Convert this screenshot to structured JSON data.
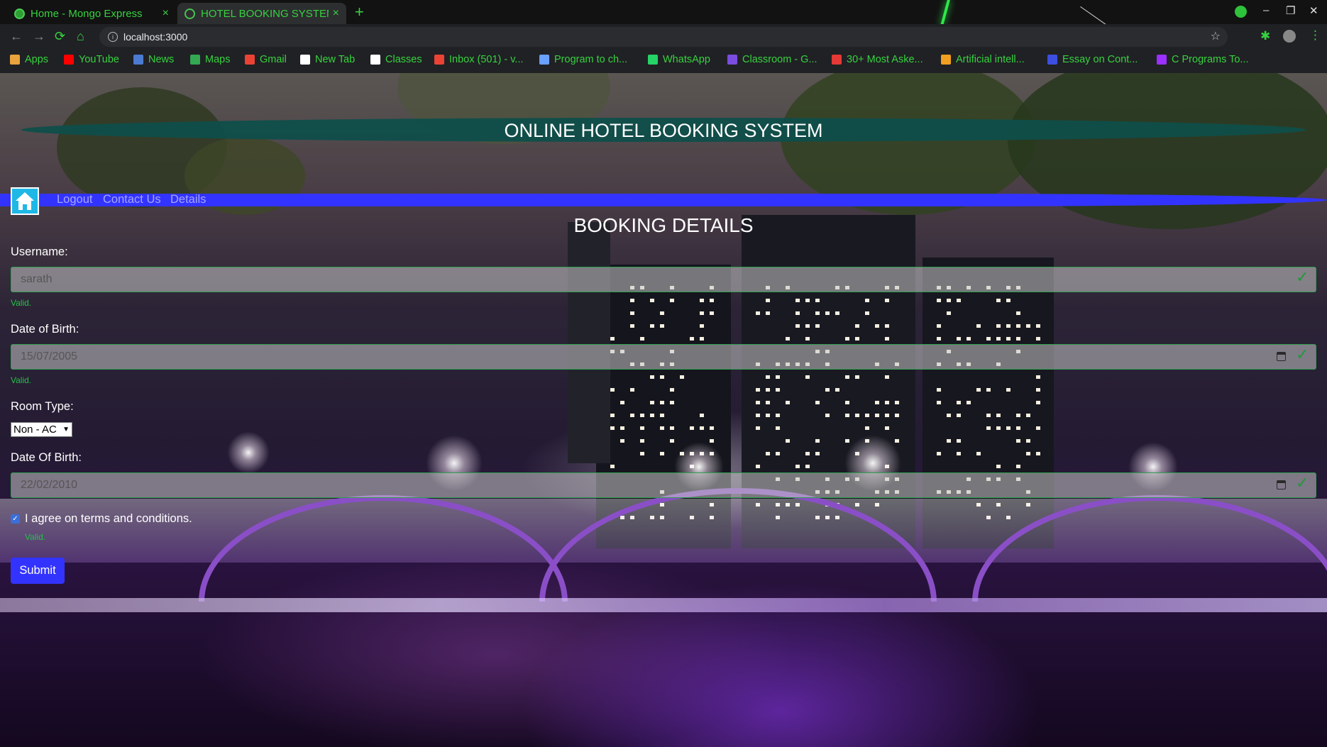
{
  "browser": {
    "tabs": [
      {
        "title": "Home - Mongo Express",
        "close": "×"
      },
      {
        "title": "HOTEL BOOKING SYSTEM",
        "close": "×"
      }
    ],
    "new_tab": "+",
    "url": "localhost:3000",
    "window_controls": {
      "minimize": "–",
      "maximize": "❐",
      "close": "✕"
    },
    "bookmarks": [
      {
        "label": "Apps",
        "icon": "apps-grid-icon",
        "color": "#e8a33d"
      },
      {
        "label": "YouTube",
        "icon": "youtube-icon",
        "color": "#ff0000"
      },
      {
        "label": "News",
        "icon": "news-icon",
        "color": "#4a7bd1"
      },
      {
        "label": "Maps",
        "icon": "maps-icon",
        "color": "#34a853"
      },
      {
        "label": "Gmail",
        "icon": "gmail-icon",
        "color": "#ea4335"
      },
      {
        "label": "New Tab",
        "icon": "new-tab-icon",
        "color": "#ffffff"
      },
      {
        "label": "Classes",
        "icon": "google-icon",
        "color": "#ffffff"
      },
      {
        "label": "Inbox (501) - v...",
        "icon": "gmail-icon",
        "color": "#ea4335"
      },
      {
        "label": "Program to ch...",
        "icon": "link-icon",
        "color": "#6aa0ff"
      },
      {
        "label": "WhatsApp",
        "icon": "whatsapp-icon",
        "color": "#25d366"
      },
      {
        "label": "Classroom - G...",
        "icon": "classroom-icon",
        "color": "#7b4ce0"
      },
      {
        "label": "30+ Most Aske...",
        "icon": "site-icon",
        "color": "#e53935"
      },
      {
        "label": "Artificial intell...",
        "icon": "site-e-icon",
        "color": "#f0a020"
      },
      {
        "label": "Essay on Cont...",
        "icon": "site-c-icon",
        "color": "#3d4fe0"
      },
      {
        "label": "C Programs To...",
        "icon": "site-p-icon",
        "color": "#9b30ff"
      }
    ]
  },
  "header": {
    "title": "ONLINE HOTEL BOOKING SYSTEM"
  },
  "nav": {
    "logout": "Logout",
    "contact": "Contact Us",
    "details": "Details"
  },
  "form": {
    "title": "BOOKING DETAILS",
    "username_label": "Username:",
    "username_value": "sarath",
    "username_valid": "Valid.",
    "dob_label": "Date of Birth:",
    "dob_value": "15/07/2005",
    "dob_valid": "Valid.",
    "room_label": "Room Type:",
    "room_value": "Non - AC",
    "date2_label": "Date Of Birth:",
    "date2_value": "22/02/2010",
    "terms_label": "I agree on terms and conditions.",
    "terms_checked": true,
    "terms_valid": "Valid.",
    "submit_label": "Submit"
  },
  "colors": {
    "accent": "#3333ff",
    "valid_green": "#22c247",
    "banner": "#0f4e4a",
    "tab_text": "#36d23f"
  }
}
